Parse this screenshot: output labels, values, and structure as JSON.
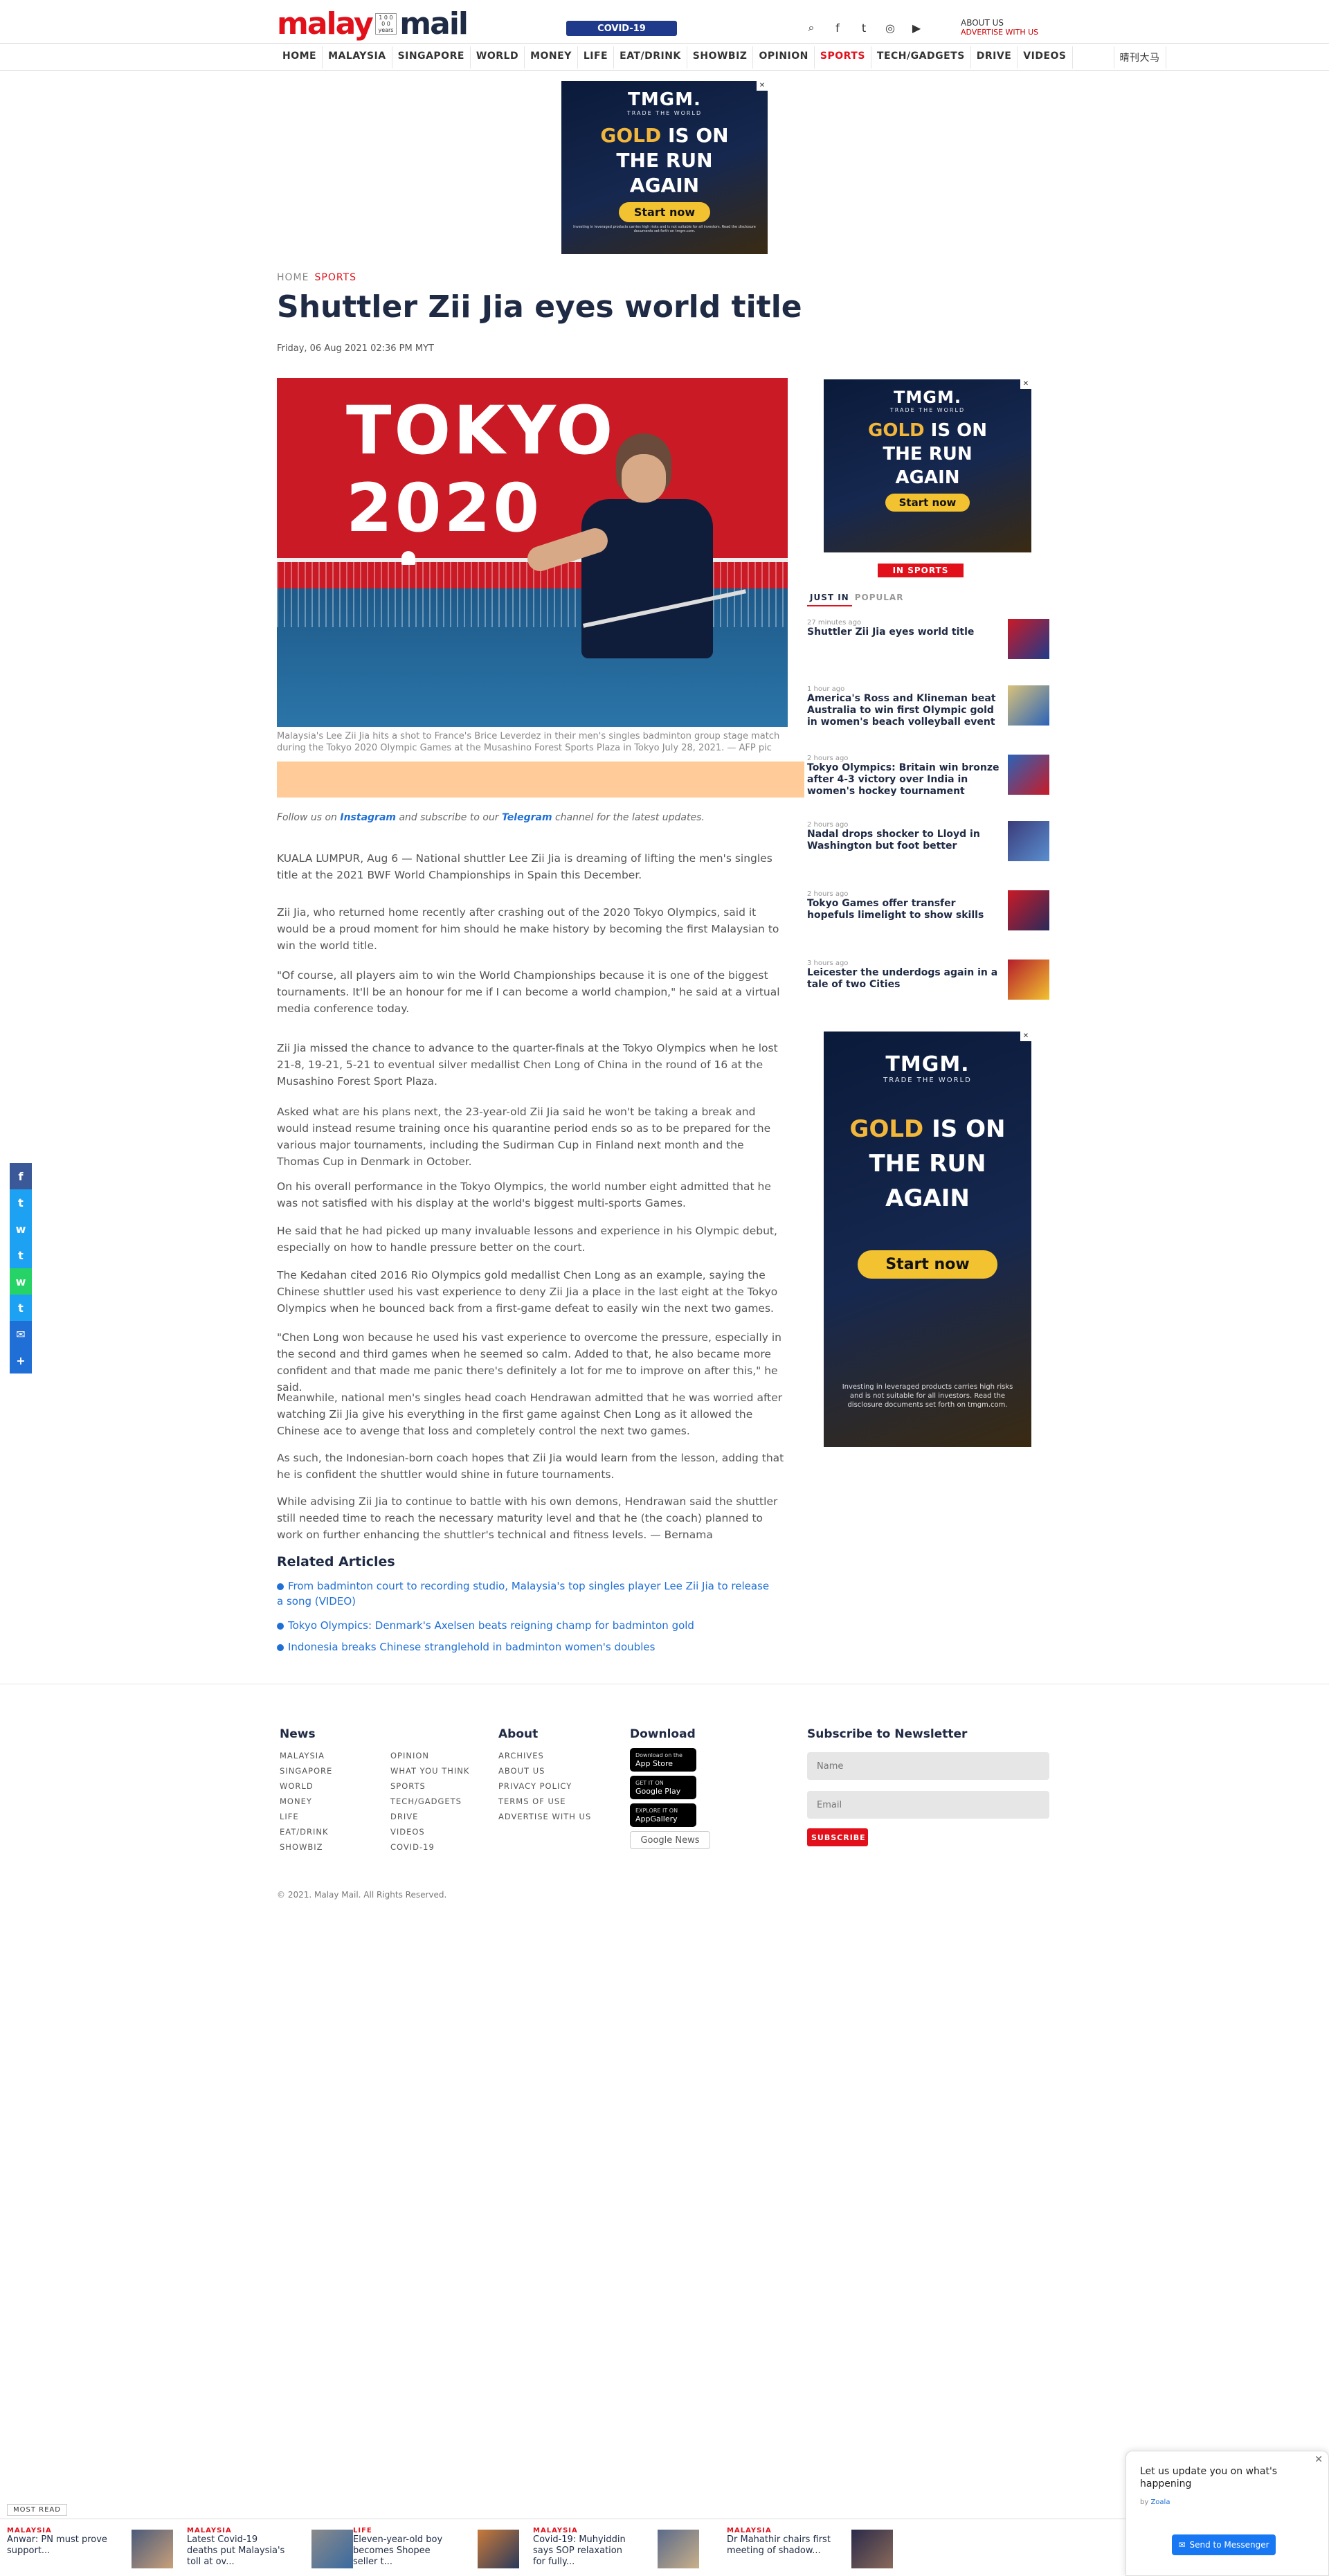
{
  "header": {
    "logo_part1": "malay",
    "logo_since": "1 0 0 0 0 years",
    "logo_part2": "mail",
    "covid_label": "COVID-19",
    "link_lifestyle": "ABOUT US",
    "link_advertise": "ADVERTISE WITH US"
  },
  "nav": {
    "items": [
      "HOME",
      "MALAYSIA",
      "SINGAPORE",
      "WORLD",
      "MONEY",
      "LIFE",
      "EAT/DRINK",
      "SHOWBIZ",
      "OPINION",
      "SPORTS",
      "TECH/GADGETS",
      "DRIVE",
      "VIDEOS",
      "",
      "晴刊大马"
    ]
  },
  "ad_top": {
    "brand": "TMGM.",
    "tag": "TRADE THE WORLD",
    "gold": "GOLD",
    "rest1": "IS ON",
    "rest2": "THE RUN",
    "rest3": "AGAIN",
    "cta": "Start now",
    "fine": "Investing in leveraged products carries high risks and is not suitable for all investors. Read the disclosure documents set forth on tmgm.com."
  },
  "breadcrumb": {
    "home": "HOME",
    "section": "SPORTS"
  },
  "article": {
    "title": "Shuttler Zii Jia eyes world title",
    "date": "Friday, 06 Aug 2021 02:36 PM MYT",
    "hero_text": "TOKYO 2020",
    "caption": "Malaysia's Lee Zii Jia hits a shot to France's Brice Leverdez in their men's singles badminton group stage match during the Tokyo 2020 Olympic Games at the Musashino Forest Sports Plaza in Tokyo July 28, 2021. — AFP pic",
    "follow_prefix": "Follow us on",
    "follow_instagram": "Instagram",
    "follow_mid": "and subscribe to our",
    "follow_telegram": "Telegram",
    "follow_suffix": "channel for the latest updates.",
    "paragraphs": [
      "KUALA LUMPUR, Aug 6 — National shuttler Lee Zii Jia is dreaming of lifting the men's singles title at the 2021 BWF World Championships in Spain this December.",
      "Zii Jia, who returned home recently after crashing out of the 2020 Tokyo Olympics, said it would be a proud moment for him should he make history by becoming the first Malaysian to win the world title.",
      "\"Of course, all players aim to win the World Championships because it is one of the biggest tournaments. It'll be an honour for me if I can become a world champion,\" he said at a virtual media conference today.",
      "Zii Jia missed the chance to advance to the quarter-finals at the Tokyo Olympics when he lost 21-8, 19-21, 5-21 to eventual silver medallist Chen Long of China in the round of 16 at the Musashino Forest Sport Plaza.",
      "Asked what are his plans next, the 23-year-old Zii Jia said he won't be taking a break and would instead resume training once his quarantine period ends so as to be prepared for the various major tournaments, including the Sudirman Cup in Finland next month and the Thomas Cup in Denmark in October.",
      "On his overall performance in the Tokyo Olympics, the world number eight admitted that he was not satisfied with his display at the world's biggest multi-sports Games.",
      "He said that he had picked up many invaluable lessons and experience in his Olympic debut, especially on how to handle pressure better on the court.",
      "The Kedahan cited 2016 Rio Olympics gold medallist Chen Long as an example, saying the Chinese shuttler used his vast experience to deny Zii Jia a place in the last eight at the Tokyo Olympics when he bounced back from a first-game defeat to easily win the next two games.",
      "\"Chen Long won because he used his vast experience to overcome the pressure, especially in the second and third games when he seemed so calm. Added to that, he also became more confident and that made me panic there's definitely a lot for me to improve on after this,\" he said.",
      "Meanwhile, national men's singles head coach Hendrawan admitted that he was worried after watching Zii Jia give his everything in the first game against Chen Long as it allowed the Chinese ace to avenge that loss and completely control the next two games.",
      "As such, the Indonesian-born coach hopes that Zii Jia would learn from the lesson, adding that he is confident the shuttler would shine in future tournaments.",
      "While advising Zii Jia to continue to battle with his own demons, Hendrawan said the shuttler still needed time to reach the necessary maturity level and that he (the coach) planned to work on further enhancing the shuttler's technical and fitness levels. — Bernama"
    ]
  },
  "related": {
    "heading": "Related Articles",
    "items": [
      "From badminton court to recording studio, Malaysia's top singles player Lee Zii Jia to release a song (VIDEO)",
      "Tokyo Olympics: Denmark's Axelsen beats reigning champ for badminton gold",
      "Indonesia breaks Chinese stranglehold in badminton women's doubles"
    ]
  },
  "sidebar": {
    "section_label": "IN SPORTS",
    "tab_just_in": "JUST IN",
    "tab_popular": "POPULAR",
    "items": [
      {
        "ago": "27 minutes ago",
        "title": "Shuttler Zii Jia eyes world title"
      },
      {
        "ago": "1 hour ago",
        "title": "America's Ross and Klineman beat Australia to win first Olympic gold in women's beach volleyball event"
      },
      {
        "ago": "2 hours ago",
        "title": "Tokyo Olympics: Britain win bronze after 4-3 victory over India in women's hockey tournament"
      },
      {
        "ago": "2 hours ago",
        "title": "Nadal drops shocker to Lloyd in Washington but foot better"
      },
      {
        "ago": "2 hours ago",
        "title": "Tokyo Games offer transfer hopefuls limelight to show skills"
      },
      {
        "ago": "3 hours ago",
        "title": "Leicester the underdogs again in a tale of two Cities"
      }
    ]
  },
  "footer": {
    "news_h": "News",
    "about_h": "About",
    "download_h": "Download",
    "newsletter_h": "Subscribe to Newsletter",
    "news_col1": [
      "MALAYSIA",
      "SINGAPORE",
      "WORLD",
      "MONEY",
      "LIFE",
      "EAT/DRINK",
      "SHOWBIZ"
    ],
    "news_col2": [
      "OPINION",
      "WHAT YOU THINK",
      "SPORTS",
      "TECH/GADGETS",
      "DRIVE",
      "VIDEOS",
      "COVID-19"
    ],
    "about_links": [
      "ARCHIVES",
      "ABOUT US",
      "PRIVACY POLICY",
      "TERMS OF USE",
      "ADVERTISE WITH US"
    ],
    "app_store": "App Store",
    "app_store_small": "Download on the",
    "google_play": "Google Play",
    "google_play_small": "GET IT ON",
    "app_gallery": "AppGallery",
    "app_gallery_small": "EXPLORE IT ON",
    "google_news": "Google News",
    "name_placeholder": "Name",
    "email_placeholder": "Email",
    "subscribe": "SUBSCRIBE",
    "copyright": "© 2021. Malay Mail. All Rights Reserved."
  },
  "most_read": {
    "label": "MOST READ",
    "items": [
      {
        "cat": "MALAYSIA",
        "text": "Anwar: PN must prove support..."
      },
      {
        "cat": "MALAYSIA",
        "text": "Latest Covid-19 deaths put Malaysia's toll at ov..."
      },
      {
        "cat": "LIFE",
        "text": "Eleven-year-old boy becomes Shopee seller t..."
      },
      {
        "cat": "MALAYSIA",
        "text": "Covid-19: Muhyiddin says SOP relaxation for fully..."
      },
      {
        "cat": "MALAYSIA",
        "text": "Dr Mahathir chairs first meeting of shadow..."
      }
    ]
  },
  "messenger": {
    "question": "Let us update you on what's happening",
    "by": "by",
    "brand": "Zoala",
    "send": "Send to Messenger"
  },
  "share": [
    "f",
    "t",
    "w",
    "t",
    "w",
    "t",
    "✉",
    "+"
  ]
}
